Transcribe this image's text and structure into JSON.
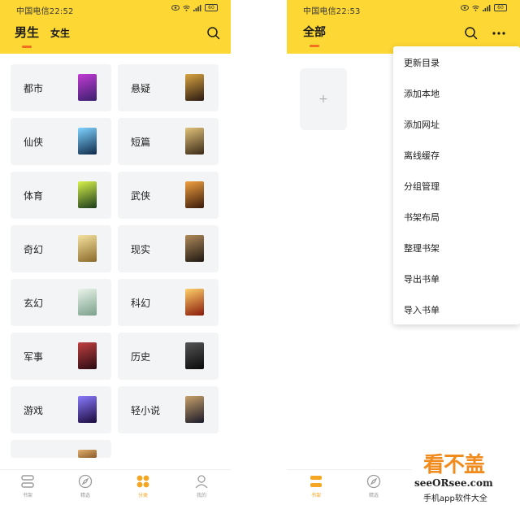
{
  "left_screen": {
    "status": {
      "text": "中国电信22:52",
      "battery": "60"
    },
    "tabs": {
      "active": "男生",
      "inactive": "女生"
    },
    "icons": {
      "search": "search-icon"
    },
    "categories": [
      {
        "name": "都市",
        "cover_color": "#5b2a86"
      },
      {
        "name": "悬疑",
        "cover_color": "#3b2a1f"
      },
      {
        "name": "仙侠",
        "cover_color": "#1e4f7a"
      },
      {
        "name": "短篇",
        "cover_color": "#6b5a3c"
      },
      {
        "name": "体育",
        "cover_color": "#1f5a2e"
      },
      {
        "name": "武侠",
        "cover_color": "#7a3b1f"
      },
      {
        "name": "奇幻",
        "cover_color": "#c9a04d"
      },
      {
        "name": "现实",
        "cover_color": "#4a3a2a"
      },
      {
        "name": "玄幻",
        "cover_color": "#a8c7a0"
      },
      {
        "name": "科幻",
        "cover_color": "#b84a1a"
      },
      {
        "name": "军事",
        "cover_color": "#6a1f2a"
      },
      {
        "name": "历史",
        "cover_color": "#1a1a1a"
      },
      {
        "name": "游戏",
        "cover_color": "#3a2a7a"
      },
      {
        "name": "轻小说",
        "cover_color": "#2a2a3a"
      },
      {
        "name": "",
        "cover_color": "#b8864a"
      }
    ],
    "bottom_nav": [
      {
        "label": "书架",
        "icon": "bookshelf-icon",
        "active": false
      },
      {
        "label": "精选",
        "icon": "compass-icon",
        "active": false
      },
      {
        "label": "分类",
        "icon": "category-icon",
        "active": true
      },
      {
        "label": "我的",
        "icon": "profile-icon",
        "active": false
      }
    ]
  },
  "right_screen": {
    "status": {
      "text": "中国电信22:53",
      "battery": "60"
    },
    "title": "全部",
    "icons": {
      "search": "search-icon",
      "more": "more-icon"
    },
    "add_tile": "+",
    "menu_items": [
      "更新目录",
      "添加本地",
      "添加网址",
      "离线缓存",
      "分组管理",
      "书架布局",
      "整理书架",
      "导出书单",
      "导入书单"
    ],
    "bottom_nav": [
      {
        "label": "书架",
        "icon": "bookshelf-icon",
        "active": true
      },
      {
        "label": "精选",
        "icon": "compass-icon",
        "active": false
      }
    ]
  },
  "watermark": {
    "logo_a": "看不",
    "logo_b": "盖",
    "site": "seeORsee.com",
    "sub": "手机app软件大全"
  },
  "colors": {
    "accent": "#fdd733",
    "indicator": "#f37021",
    "active_nav": "#f5a623",
    "card_bg": "#f3f4f6"
  }
}
